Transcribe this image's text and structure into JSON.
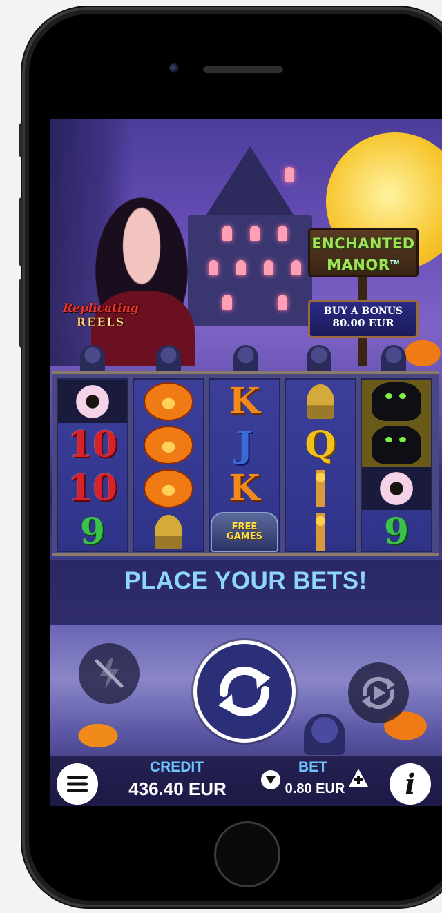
{
  "game": {
    "title_line1": "ENCHANTED",
    "title_line2": "MANOR",
    "trademark": "TM",
    "feature_line1": "Replicating",
    "feature_line2": "REELS"
  },
  "bonus": {
    "label": "BUY A BONUS",
    "price": "80.00 EUR"
  },
  "reels": [
    [
      "bat",
      "10",
      "10",
      "9"
    ],
    [
      "pumpkin",
      "pumpkin",
      "pumpkin",
      "goblet"
    ],
    [
      "K",
      "J",
      "K",
      "free-games"
    ],
    [
      "goblet",
      "Q",
      "candelabra",
      "candelabra"
    ],
    [
      "black-cat",
      "black-cat",
      "bat",
      "9"
    ]
  ],
  "free_games": {
    "line1": "FREE",
    "line2": "GAMES"
  },
  "message": "PLACE YOUR BETS!",
  "controls": {
    "turbo_icon": "lightning-disabled-icon",
    "spin_icon": "spin-refresh-icon",
    "autoplay_icon": "autoplay-icon"
  },
  "footer": {
    "credit_label": "CREDIT",
    "credit_value": "436.40 EUR",
    "bet_label": "BET",
    "bet_value": "0.80 EUR",
    "menu_icon": "hamburger-menu-icon",
    "info_icon": "info-icon",
    "info_glyph": "i"
  },
  "colors": {
    "label_blue": "#6fc6ff",
    "message_blue": "#8fd6ff",
    "title_green": "#9fe35a"
  }
}
